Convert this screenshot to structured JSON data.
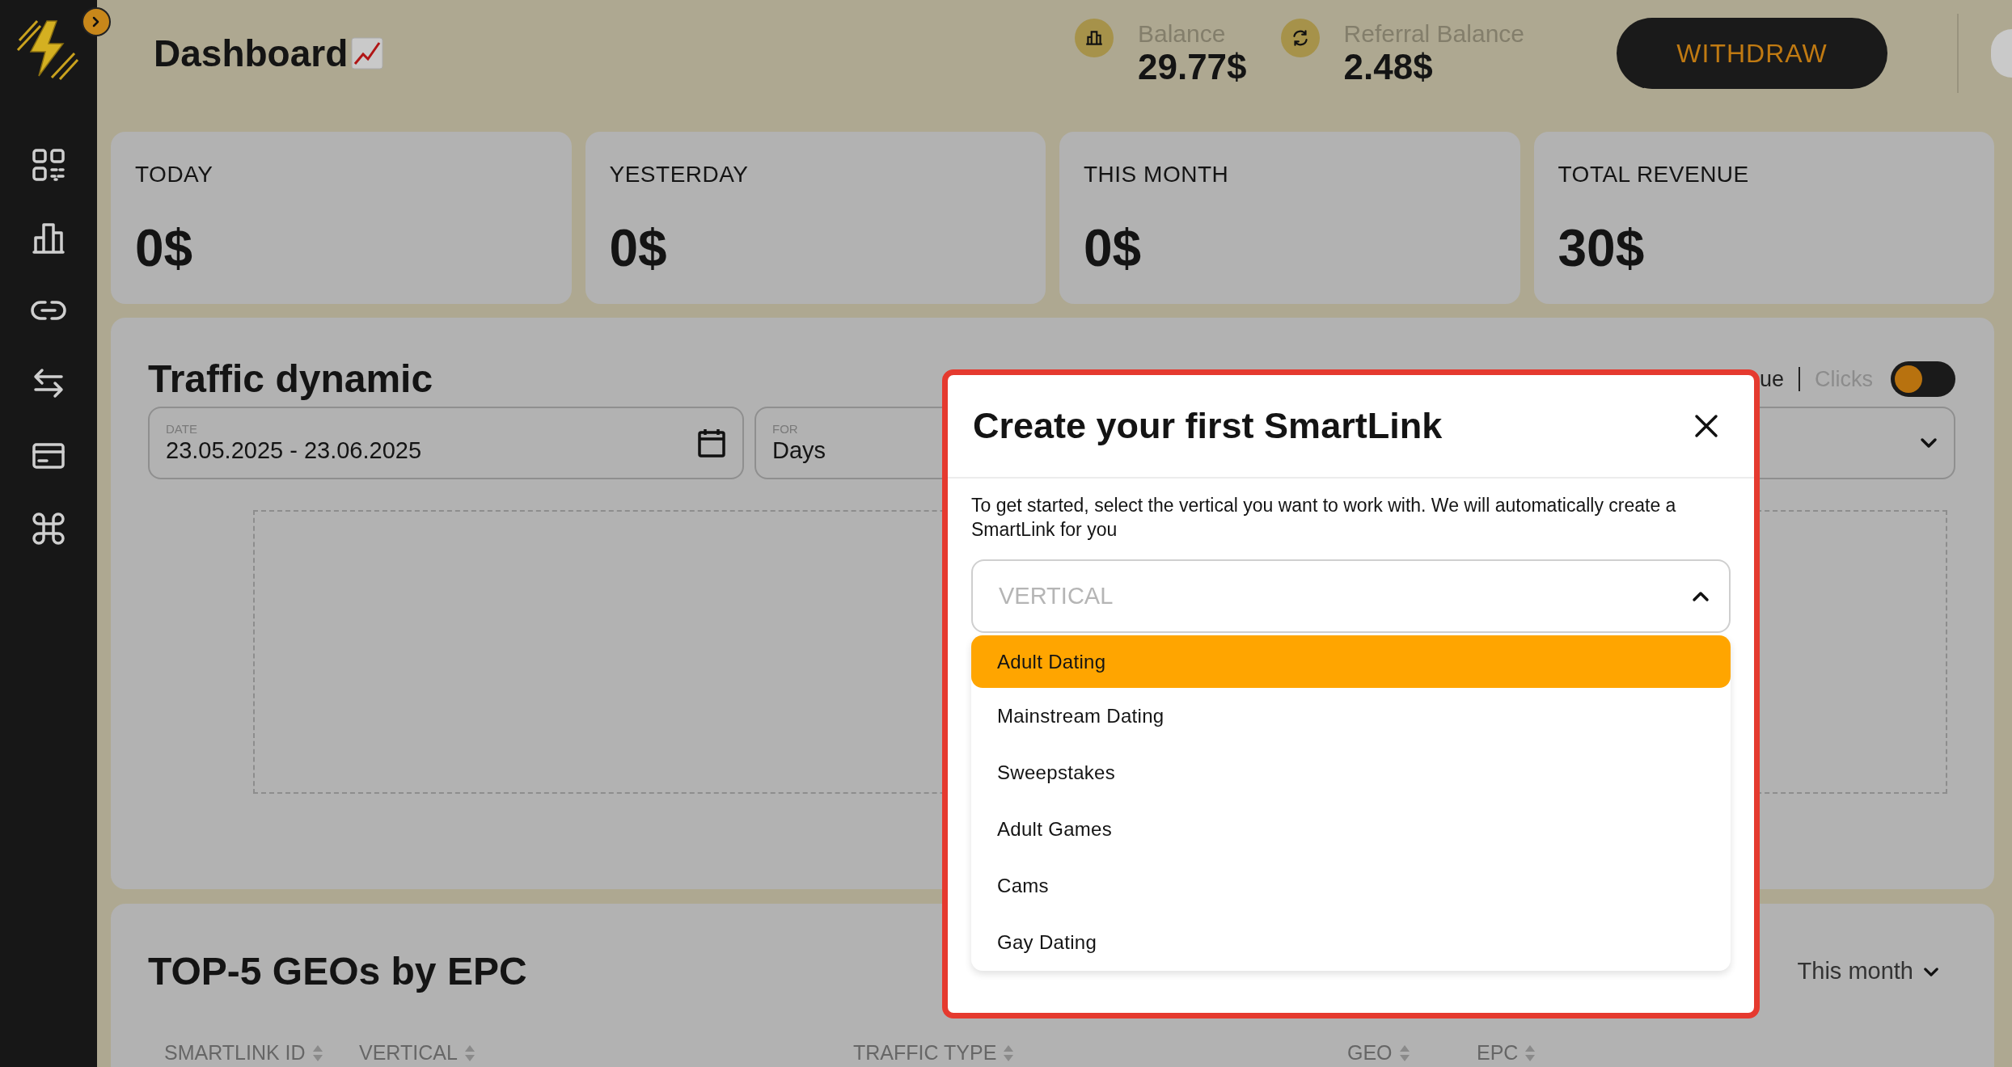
{
  "header": {
    "title": "Dashboard",
    "balances": [
      {
        "label": "Balance",
        "value": "29.77$"
      },
      {
        "label": "Referral Balance",
        "value": "2.48$"
      }
    ],
    "withdraw_button": "WITHDRAW"
  },
  "stats": [
    {
      "label": "TODAY",
      "value": "0$"
    },
    {
      "label": "YESTERDAY",
      "value": "0$"
    },
    {
      "label": "THIS MONTH",
      "value": "0$"
    },
    {
      "label": "TOTAL REVENUE",
      "value": "30$"
    }
  ],
  "traffic": {
    "title": "Traffic dynamic",
    "metric_toggle": {
      "label_1": "ue",
      "label_2": "Clicks",
      "on": false
    },
    "date_field": {
      "label": "DATE",
      "value": "23.05.2025 - 23.06.2025"
    },
    "period_field": {
      "label": "FOR",
      "value": "Days"
    }
  },
  "top_geos": {
    "title": "TOP-5 GEOs by EPC",
    "period": "This month",
    "columns": [
      "SMARTLINK ID",
      "VERTICAL",
      "TRAFFIC TYPE",
      "GEO",
      "EPC"
    ]
  },
  "modal": {
    "title": "Create your first SmartLink",
    "description": "To get started, select the vertical you want to work with. We will automatically create a SmartLink for you",
    "select": {
      "placeholder": "VERTICAL",
      "expanded": true
    },
    "options": [
      {
        "label": "Adult Dating",
        "selected": true
      },
      {
        "label": "Mainstream Dating",
        "selected": false
      },
      {
        "label": "Sweepstakes",
        "selected": false
      },
      {
        "label": "Adult Games",
        "selected": false
      },
      {
        "label": "Cams",
        "selected": false
      },
      {
        "label": "Gay Dating",
        "selected": false
      }
    ]
  }
}
